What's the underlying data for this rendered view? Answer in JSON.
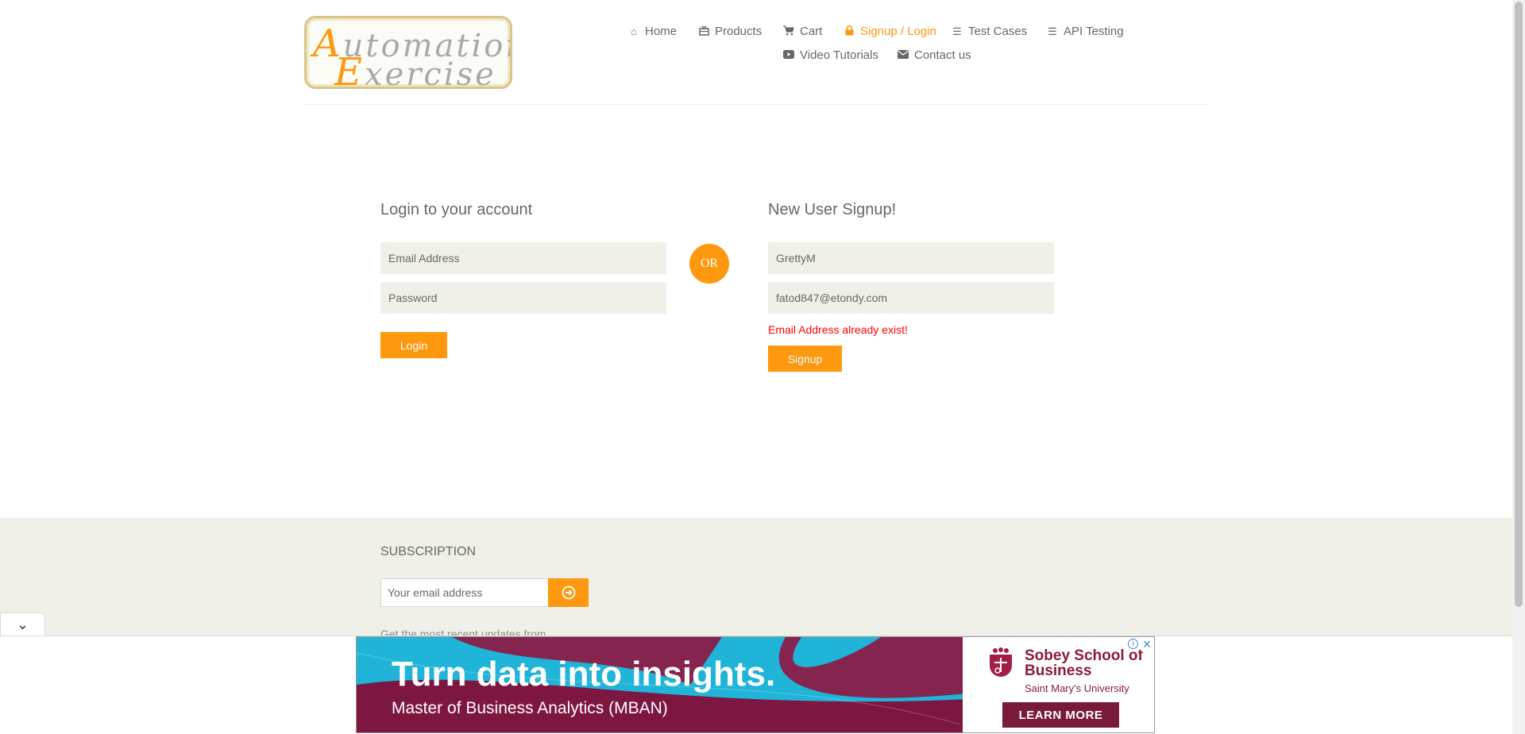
{
  "logo": {
    "line1_cap": "A",
    "line1_rest": "utomation",
    "line2_cap": "E",
    "line2_rest": "xercise"
  },
  "nav": {
    "home": "Home",
    "products": "Products",
    "cart": "Cart",
    "signup_login": "Signup / Login",
    "test_cases": "Test Cases",
    "api_testing": "API Testing",
    "video_tutorials": "Video Tutorials",
    "contact_us": "Contact us"
  },
  "login": {
    "title": "Login to your account",
    "email_placeholder": "Email Address",
    "password_placeholder": "Password",
    "button": "Login"
  },
  "divider": "OR",
  "signup": {
    "title": "New User Signup!",
    "name_value": "GrettyM",
    "email_value": "fatod847@etondy.com",
    "error": "Email Address already exist!",
    "button": "Signup"
  },
  "footer": {
    "subscription_title": "SUBSCRIPTION",
    "email_placeholder": "Your email address",
    "hint": "Get the most recent updates from"
  },
  "ad": {
    "headline": "Turn data into insights.",
    "subline": "Master of Business Analytics (MBAN)",
    "brand_name": "Sobey School of Business",
    "brand_sub": "Saint Mary's University",
    "cta": "LEARN MORE"
  },
  "colors": {
    "accent": "#fe980f",
    "error": "#ff0000",
    "footer_bg": "#f0f0e9",
    "ad_bg": "#1fb4d8",
    "ad_brand": "#7a1a3a"
  }
}
